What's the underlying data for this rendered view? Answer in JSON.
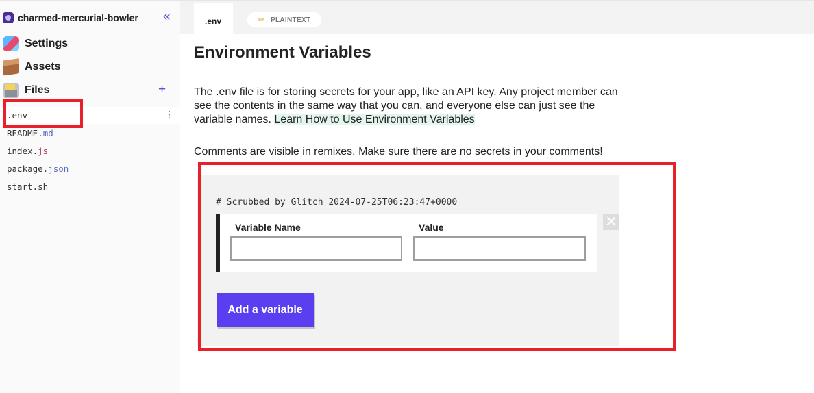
{
  "project": {
    "name": "charmed-mercurial-bowler"
  },
  "sidebar": {
    "nav": [
      {
        "label": "Settings",
        "icon": "settings-icon"
      },
      {
        "label": "Assets",
        "icon": "assets-icon"
      },
      {
        "label": "Files",
        "icon": "files-icon"
      }
    ],
    "files": [
      {
        "base": ".env",
        "ext": "",
        "active": true
      },
      {
        "base": "README.",
        "ext": "md"
      },
      {
        "base": "index.",
        "ext": "js"
      },
      {
        "base": "package.",
        "ext": "json"
      },
      {
        "base": "start.sh",
        "ext": ""
      }
    ]
  },
  "tabs": {
    "active_label": ".env",
    "language": "PLAINTEXT"
  },
  "content": {
    "title": "Environment Variables",
    "description": "The .env file is for storing secrets for your app, like an API key. Any project member can see the contents in the same way that you can, and everyone else can just see the variable names. ",
    "learn_link": "Learn How to Use Environment Variables",
    "comments_note": "Comments are visible in remixes. Make sure there are no secrets in your comments!"
  },
  "editor": {
    "comment_line": "# Scrubbed by Glitch 2024-07-25T06:23:47+0000",
    "variable_name_label": "Variable Name",
    "value_label": "Value",
    "variable_name_value": "",
    "value_value": "",
    "remove_symbol": "✕",
    "add_button_label": "Add a variable"
  },
  "colors": {
    "accent": "#5a3ff0",
    "highlight": "#e8202a",
    "link_bg": "#e3f6ee"
  }
}
